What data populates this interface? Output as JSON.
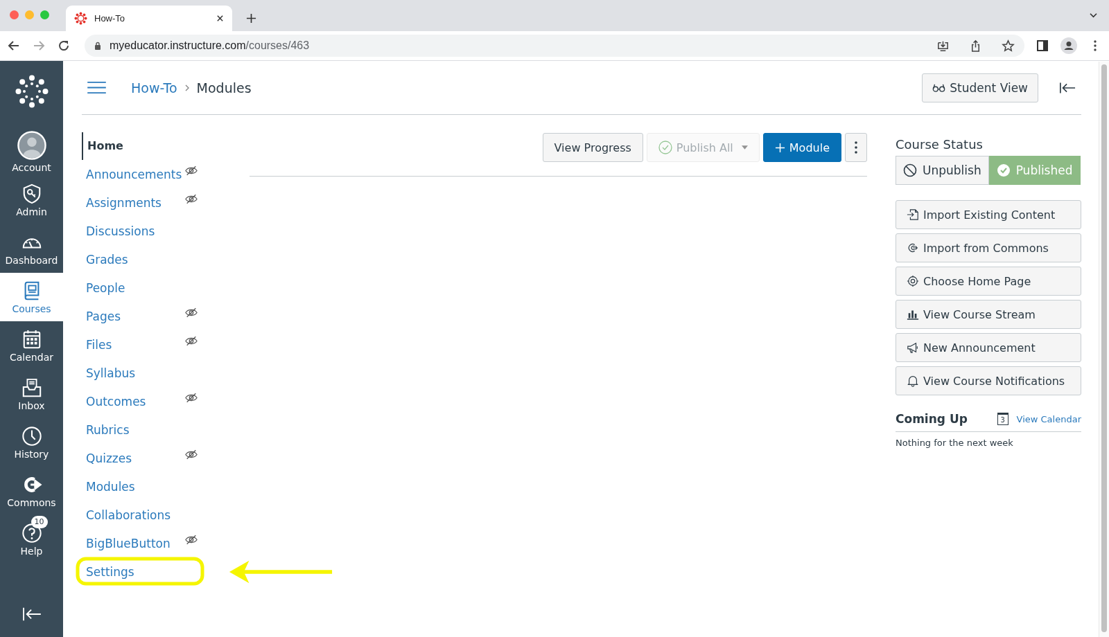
{
  "browser": {
    "tab_title": "How-To",
    "url_host": "myeducator.instructure.com",
    "url_path": "/courses/463"
  },
  "global_nav": [
    {
      "kind": "account",
      "label": "Account",
      "selected": false
    },
    {
      "kind": "admin",
      "label": "Admin",
      "selected": false
    },
    {
      "kind": "dashboard",
      "label": "Dashboard",
      "selected": false
    },
    {
      "kind": "courses",
      "label": "Courses",
      "selected": true
    },
    {
      "kind": "calendar",
      "label": "Calendar",
      "selected": false
    },
    {
      "kind": "inbox",
      "label": "Inbox",
      "selected": false
    },
    {
      "kind": "history",
      "label": "History",
      "selected": false
    },
    {
      "kind": "commons",
      "label": "Commons",
      "selected": false
    },
    {
      "kind": "help",
      "label": "Help",
      "selected": false,
      "badge": "10"
    }
  ],
  "breadcrumb": [
    "How-To",
    "Modules"
  ],
  "student_view_button": "Student View",
  "course_nav": [
    {
      "label": "Home",
      "selected": true,
      "hidden": false,
      "highlighted": false
    },
    {
      "label": "Announcements",
      "selected": false,
      "hidden": true,
      "highlighted": false
    },
    {
      "label": "Assignments",
      "selected": false,
      "hidden": true,
      "highlighted": false
    },
    {
      "label": "Discussions",
      "selected": false,
      "hidden": false,
      "highlighted": false
    },
    {
      "label": "Grades",
      "selected": false,
      "hidden": false,
      "highlighted": false
    },
    {
      "label": "People",
      "selected": false,
      "hidden": false,
      "highlighted": false
    },
    {
      "label": "Pages",
      "selected": false,
      "hidden": true,
      "highlighted": false
    },
    {
      "label": "Files",
      "selected": false,
      "hidden": true,
      "highlighted": false
    },
    {
      "label": "Syllabus",
      "selected": false,
      "hidden": false,
      "highlighted": false
    },
    {
      "label": "Outcomes",
      "selected": false,
      "hidden": true,
      "highlighted": false
    },
    {
      "label": "Rubrics",
      "selected": false,
      "hidden": false,
      "highlighted": false
    },
    {
      "label": "Quizzes",
      "selected": false,
      "hidden": true,
      "highlighted": false
    },
    {
      "label": "Modules",
      "selected": false,
      "hidden": false,
      "highlighted": false
    },
    {
      "label": "Collaborations",
      "selected": false,
      "hidden": false,
      "highlighted": false
    },
    {
      "label": "BigBlueButton",
      "selected": false,
      "hidden": true,
      "highlighted": false
    },
    {
      "label": "Settings",
      "selected": false,
      "hidden": false,
      "highlighted": true
    }
  ],
  "toolbar": [
    {
      "kind": "plain",
      "label": "View Progress",
      "disabled": false
    },
    {
      "kind": "publish",
      "label": "Publish All",
      "disabled": true
    },
    {
      "kind": "primary",
      "label": "Module",
      "disabled": false
    },
    {
      "kind": "more",
      "disabled": false
    }
  ],
  "course_status": {
    "title": "Course Status",
    "options": [
      {
        "kind": "unpublish",
        "label": "Unpublish",
        "selected": false
      },
      {
        "kind": "published",
        "label": "Published",
        "selected": true
      }
    ]
  },
  "actions": [
    {
      "kind": "import",
      "label": "Import Existing Content"
    },
    {
      "kind": "commons",
      "label": "Import from Commons"
    },
    {
      "kind": "target",
      "label": "Choose Home Page"
    },
    {
      "kind": "stream",
      "label": "View Course Stream"
    },
    {
      "kind": "megaphone",
      "label": "New Announcement"
    },
    {
      "kind": "bell",
      "label": "View Course Notifications"
    }
  ],
  "coming_up": {
    "title": "Coming Up",
    "calendar_day": "3",
    "link": "View Calendar",
    "empty_text": "Nothing for the next week"
  }
}
